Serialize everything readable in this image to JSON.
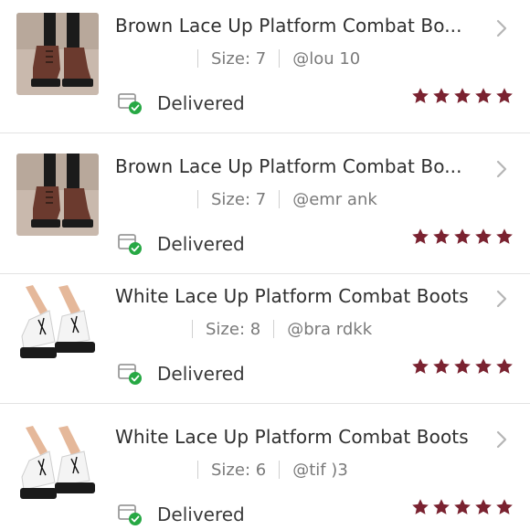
{
  "orders": [
    {
      "title": "Brown Lace Up Platform Combat Bo...",
      "size_label": "Size: 7",
      "buyer": "@lou     10",
      "status": "Delivered",
      "rating": 5,
      "thumb_icon": "brown-boots-photo",
      "accent_color": "#7a2230"
    },
    {
      "title": "Brown Lace Up Platform Combat Bo...",
      "size_label": "Size: 7",
      "buyer": "@emr      ank",
      "status": "Delivered",
      "rating": 5,
      "thumb_icon": "brown-boots-photo",
      "accent_color": "#7a2230"
    },
    {
      "title": "White Lace Up Platform Combat Boots",
      "size_label": "Size: 8",
      "buyer": "@bra     rdkk",
      "status": "Delivered",
      "rating": 5,
      "thumb_icon": "white-boots-photo",
      "accent_color": "#7a2230"
    },
    {
      "title": "White Lace Up Platform Combat Boots",
      "size_label": "Size: 6",
      "buyer": "@tif  )3",
      "status": "Delivered",
      "rating": 5,
      "thumb_icon": "white-boots-photo",
      "accent_color": "#7a2230"
    }
  ],
  "colors": {
    "star": "#7a2230",
    "check": "#27a844",
    "divider": "#e3e3e3"
  }
}
